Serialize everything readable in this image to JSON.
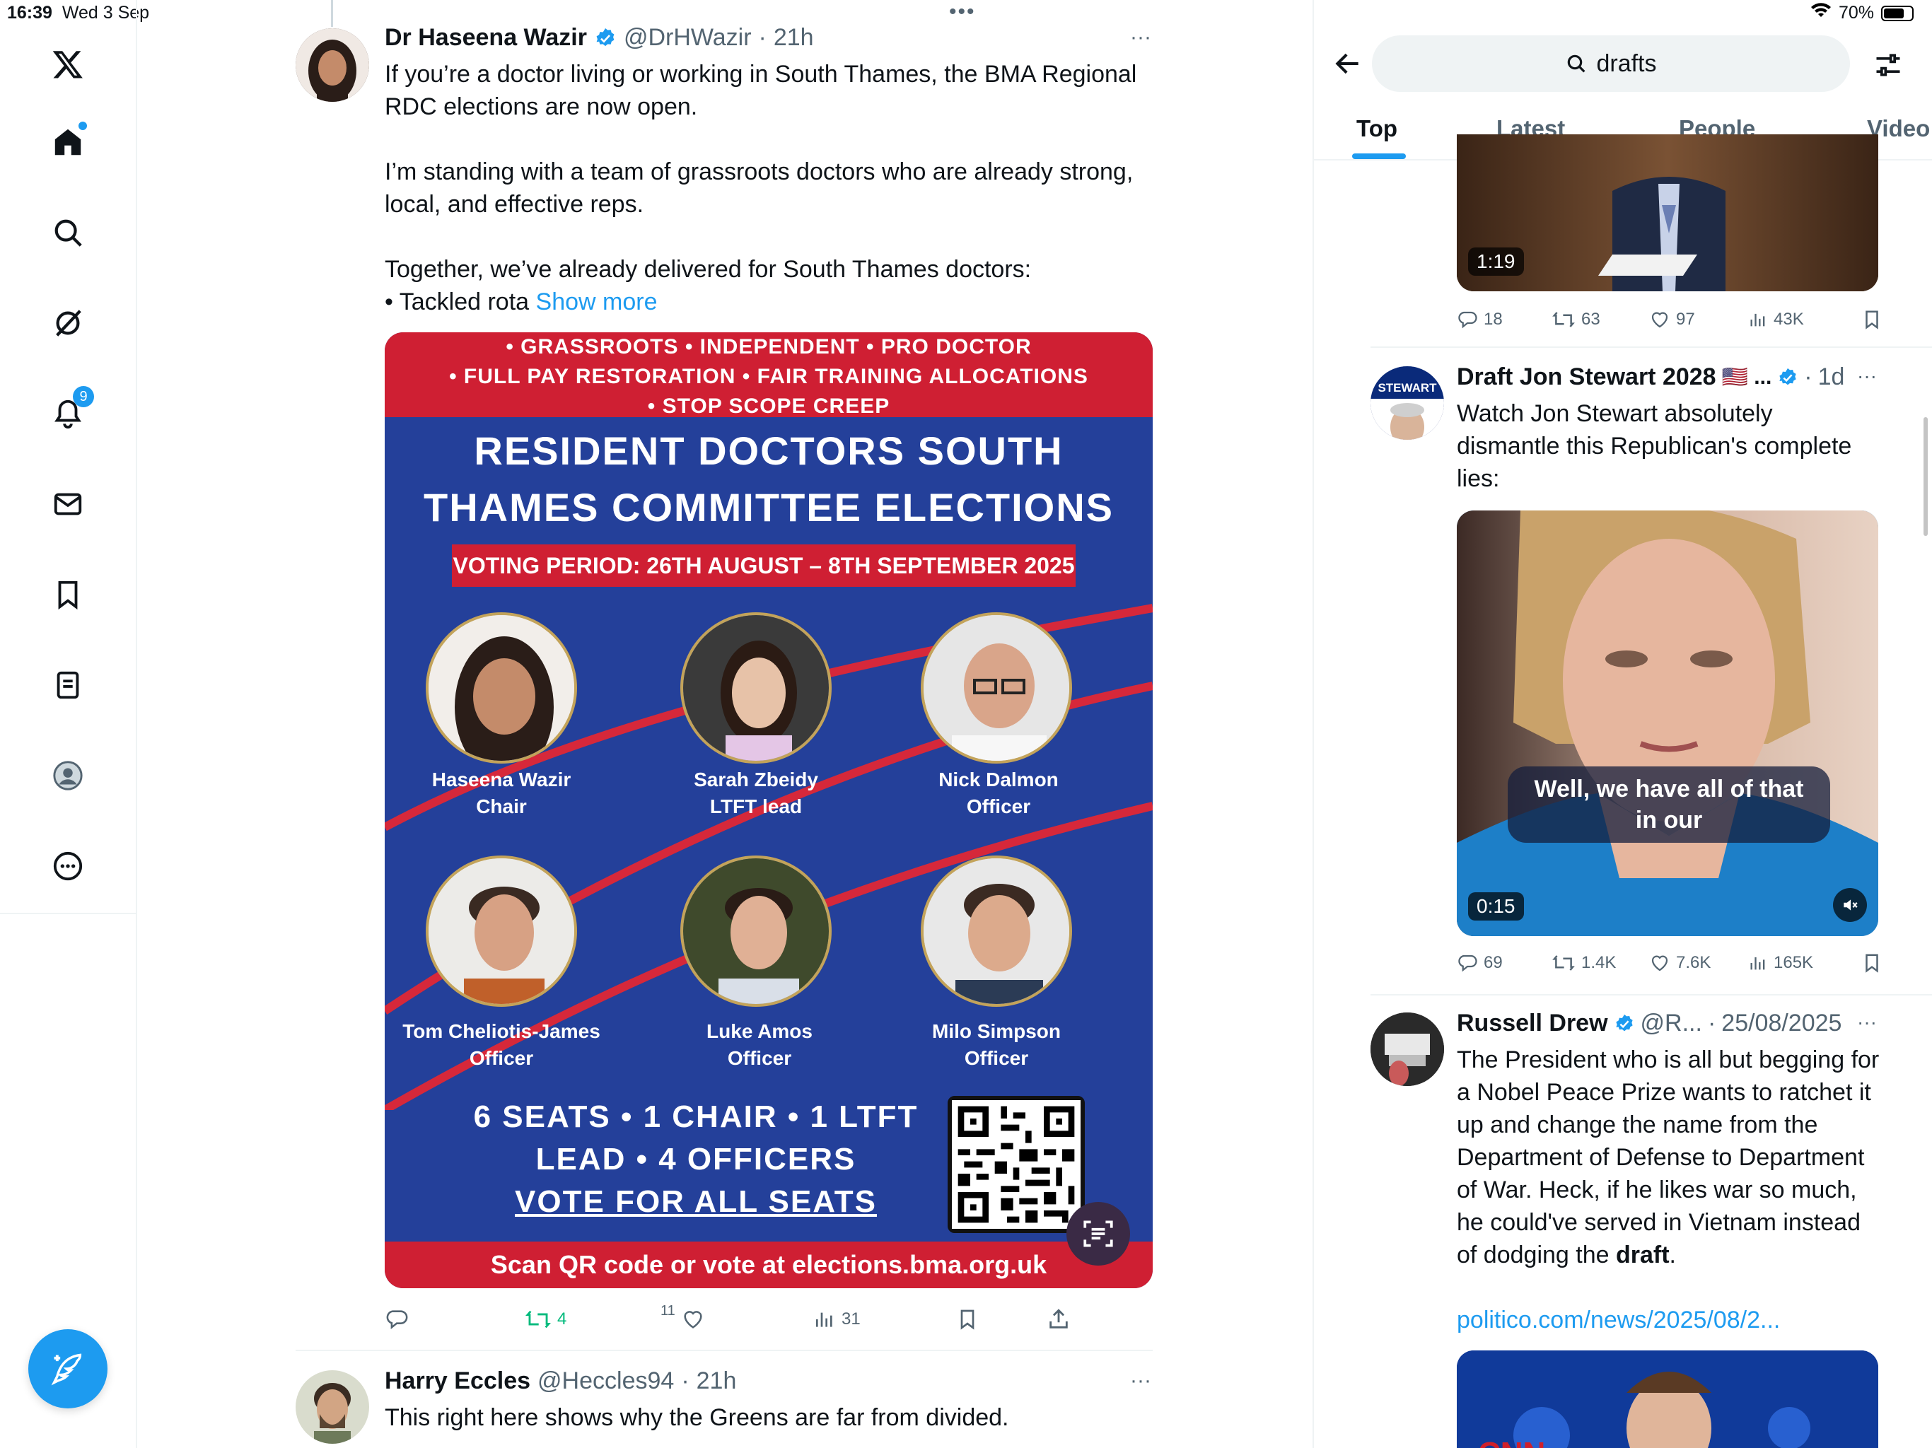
{
  "status_bar": {
    "time": "16:39",
    "date": "Wed 3 Sep",
    "battery": "70%"
  },
  "nav": {
    "items": [
      "x-logo-icon",
      "home-icon",
      "search-icon",
      "grok-icon",
      "notifications-icon",
      "messages-icon",
      "bookmarks-icon",
      "lists-icon",
      "profile-icon",
      "more-icon"
    ],
    "notifications_badge": "9",
    "compose_label": "Post"
  },
  "feed": {
    "more_dots": "•••",
    "tweet1": {
      "name": "Dr Haseena Wazir",
      "handle": "@DrHWazir",
      "time": "21h",
      "text1": "If you’re a doctor living or working in South Thames, the BMA Regional RDC elections are now open.",
      "text2": "I’m standing with a team of grassroots doctors who are already strong, local, and effective reps.",
      "text3": "Together, we’ve already delivered for South Thames doctors:",
      "text4": "• Tackled rota",
      "show_more": "Show more",
      "poster": {
        "top_line1": "• GRASSROOTS • INDEPENDENT • PRO DOCTOR",
        "top_line2": "• FULL PAY RESTORATION • FAIR TRAINING ALLOCATIONS",
        "top_line3": "• STOP SCOPE CREEP",
        "headline1": "RESIDENT DOCTORS SOUTH",
        "headline2": "THAMES COMMITTEE ELECTIONS",
        "voting": "VOTING PERIOD: 26TH AUGUST – 8TH SEPTEMBER 2025",
        "candidates": [
          {
            "name": "Haseena Wazir",
            "role": "Chair"
          },
          {
            "name": "Sarah Zbeidy",
            "role": "LTFT lead"
          },
          {
            "name": "Nick Dalmon",
            "role": "Officer"
          },
          {
            "name": "Tom Cheliotis-James",
            "role": "Officer"
          },
          {
            "name": "Luke Amos",
            "role": "Officer"
          },
          {
            "name": "Milo Simpson",
            "role": "Officer"
          }
        ],
        "seats1": "6 SEATS • 1 CHAIR • 1 LTFT",
        "seats2": "LEAD • 4 OFFICERS",
        "seats3": "VOTE FOR ALL SEATS",
        "bottom": "Scan QR code or vote at elections.bma.org.uk"
      },
      "retweets": "4",
      "likes": "11",
      "views": "31"
    },
    "tweet2": {
      "name": "Harry Eccles",
      "handle": "@Heccles94",
      "time": "21h",
      "text": "This right here shows why the Greens are far from divided."
    }
  },
  "search": {
    "query": "drafts",
    "tabs": [
      "Top",
      "Latest",
      "People",
      "Video"
    ],
    "active_tab": "Top",
    "result1": {
      "duration": "1:19",
      "replies": "18",
      "retweets": "63",
      "likes": "97",
      "views": "43K"
    },
    "result2": {
      "name": "Draft Jon Stewart 2028",
      "flag": "🇺🇸 ...",
      "time": "1d",
      "text": "Watch Jon Stewart absolutely dismantle this Republican's complete lies:",
      "caption": "Well, we have all of that in our",
      "duration": "0:15",
      "avatar_text": "STEWART",
      "replies": "69",
      "retweets": "1.4K",
      "likes": "7.6K",
      "views": "165K"
    },
    "result3": {
      "name": "Russell Drew",
      "handle": "@R...",
      "time": "25/08/2025",
      "text": "The President who is all but begging for a Nobel Peace Prize wants to ratchet it up and change the name from the Department of Defense to Department of War. Heck, if he likes war so much, he could've served in Vietnam instead of dodging the",
      "text_bold": "draft",
      "text_end": ".",
      "link": "politico.com/news/2025/08/2...",
      "thumb_text": "CNN"
    }
  }
}
